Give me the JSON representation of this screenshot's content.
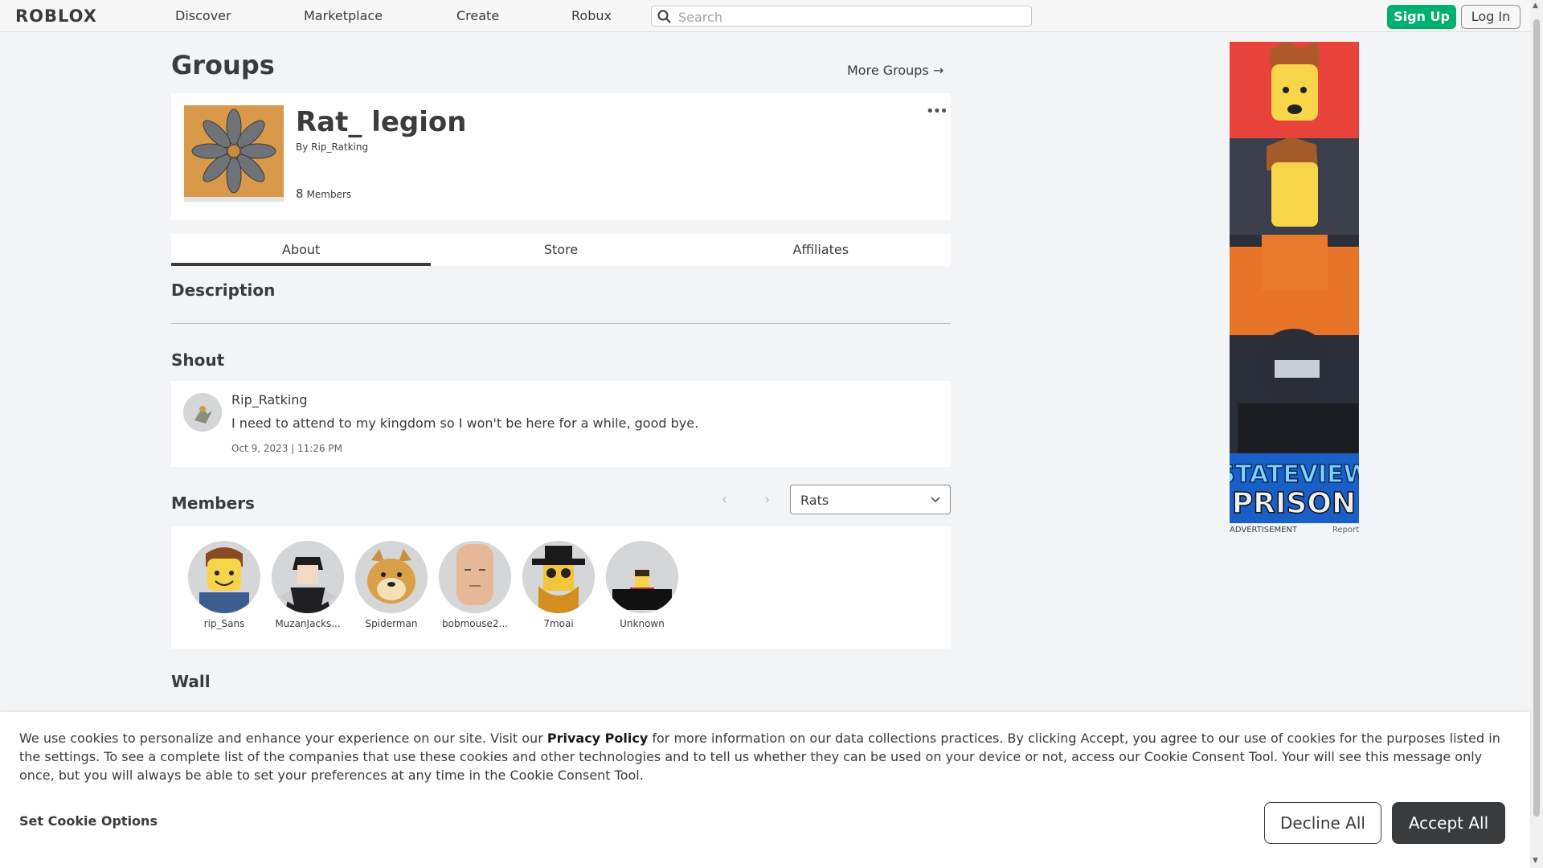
{
  "nav": {
    "logo": "ROBLOX",
    "links": [
      "Discover",
      "Marketplace",
      "Create",
      "Robux"
    ],
    "search_placeholder": "Search",
    "signup_label": "Sign Up",
    "login_label": "Log In"
  },
  "page": {
    "title": "Groups",
    "more_groups": "More Groups →"
  },
  "group": {
    "name": "Rat_ legion",
    "by_prefix": "By",
    "owner": "Rip_Ratking",
    "member_count": "8",
    "member_count_label": "Members"
  },
  "tabs": [
    "About",
    "Store",
    "Affiliates"
  ],
  "active_tab": "About",
  "sections": {
    "description": "Description",
    "shout": "Shout",
    "members": "Members",
    "wall": "Wall"
  },
  "shout": {
    "user": "Rip_Ratking",
    "text": "I need to attend to my kingdom so I won't be here for a while, good bye.",
    "date": "Oct 9, 2023 | 11:26 PM"
  },
  "members": {
    "role_selected": "Rats",
    "list": [
      {
        "name": "rip_Sans"
      },
      {
        "name": "MuzanJacks..."
      },
      {
        "name": "Spiderman"
      },
      {
        "name": "bobmouse2..."
      },
      {
        "name": "7moai"
      },
      {
        "name": "Unknown"
      }
    ]
  },
  "ad": {
    "label": "ADVERTISEMENT",
    "report": "Report",
    "artwork_text": "STATEVIEW PRISON"
  },
  "cookie": {
    "text_before": "We use cookies to personalize and enhance your experience on our site. Visit our ",
    "policy_link": "Privacy Policy",
    "text_after": " for more information on our data collections practices. By clicking Accept, you agree to our use of cookies for the purposes listed in the settings. To see a complete list of the companies that use these cookies and other technologies and to tell us whether they can be used on your device or not, access our Cookie Consent Tool. Your will see this message only once, but you will always be able to set your preferences at any time in the Cookie Consent Tool.",
    "set_options": "Set Cookie Options",
    "decline": "Decline All",
    "accept": "Accept All"
  },
  "colors": {
    "signup": "#00b06f",
    "accept": "#393b3d",
    "page_bg": "#f2f4f5"
  }
}
